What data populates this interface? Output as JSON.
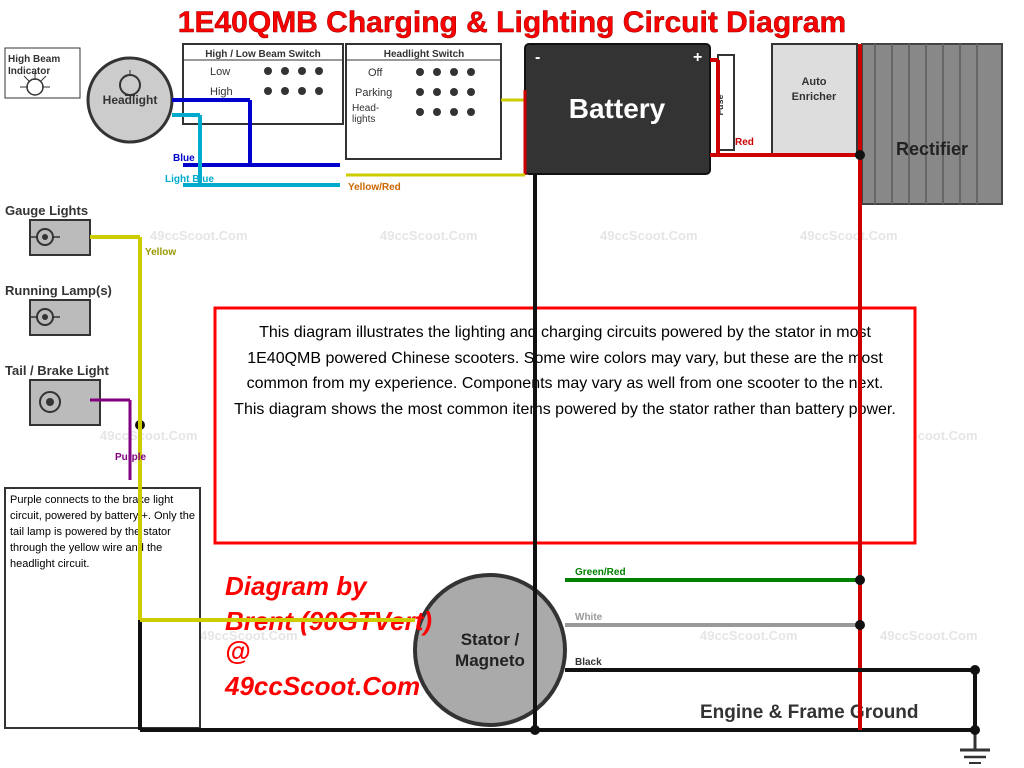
{
  "title": "1E40QMB Charging & Lighting Circuit Diagram",
  "watermarks": [
    "49ccScoot.Com"
  ],
  "switches": {
    "highLowBeam": {
      "title": "High / Low Beam Switch",
      "rows": [
        {
          "label": "Low",
          "dots": 2
        },
        {
          "label": "High",
          "dots": 2
        }
      ]
    },
    "headlight": {
      "title": "Headlight Switch",
      "rows": [
        {
          "label": "Off",
          "dots": 2
        },
        {
          "label": "Parking",
          "dots": 2
        },
        {
          "label": "Head-lights",
          "dots": 2
        }
      ]
    }
  },
  "battery": {
    "label": "Battery",
    "minus": "-",
    "plus": "+"
  },
  "fuse": {
    "label": "Fuse"
  },
  "enricher": {
    "label": "Auto\nEnricher"
  },
  "rectifier": {
    "label": "Rectifier"
  },
  "headlight": {
    "label": "Headlight"
  },
  "highBeamIndicator": {
    "label": "High Beam\nIndicator"
  },
  "gaugeLights": {
    "label": "Gauge Lights"
  },
  "runningLamps": {
    "label": "Running Lamp(s)"
  },
  "tailBrakeLight": {
    "label": "Tail / Brake Light"
  },
  "stator": {
    "label": "Stator /\nMagneto"
  },
  "wireLabels": {
    "blue": "Blue",
    "lightBlue": "Light Blue",
    "yellow": "Yellow",
    "yellowRed": "Yellow/Red",
    "purple": "Purple",
    "red": "Red",
    "greenRed": "Green/Red",
    "white": "White",
    "black": "Black"
  },
  "infoText": "This diagram illustrates the lighting and charging circuits powered by the stator in most 1E40QMB powered Chinese scooters. Some wire colors may vary, but these are the most common from my experience. Components may vary as well from one scooter to the next. This diagram shows the most common items powered by the stator rather than battery power.",
  "purpleNote": "Purple connects to the brake light circuit, powered by battery +. Only the tail lamp is powered by the stator through the yellow wire and the headlight circuit.",
  "diagramBy": "Diagram by\nBrent (90GTVert)\n@\n49ccScoot.Com",
  "groundLabel": "Engine & Frame Ground",
  "colors": {
    "red": "#cc0000",
    "blue": "#0000cc",
    "yellow": "#cccc00",
    "green": "#008000",
    "black": "#111111",
    "white": "#ffffff",
    "purple": "#800080",
    "lightBlue": "#00aacc"
  }
}
